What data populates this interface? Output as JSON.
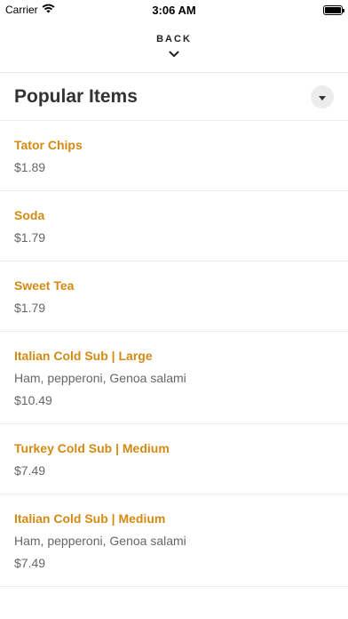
{
  "status_bar": {
    "carrier": "Carrier",
    "time": "3:06 AM"
  },
  "header": {
    "back_label": "BACK"
  },
  "section": {
    "title": "Popular Items"
  },
  "items": [
    {
      "name": "Tator Chips",
      "description": "",
      "price": "$1.89"
    },
    {
      "name": "Soda",
      "description": "",
      "price": "$1.79"
    },
    {
      "name": "Sweet Tea",
      "description": "",
      "price": "$1.79"
    },
    {
      "name": "Italian Cold Sub | Large",
      "description": "Ham, pepperoni, Genoa salami",
      "price": "$10.49"
    },
    {
      "name": "Turkey Cold Sub | Medium",
      "description": "",
      "price": "$7.49"
    },
    {
      "name": "Italian Cold Sub | Medium",
      "description": "Ham, pepperoni, Genoa salami",
      "price": "$7.49"
    }
  ],
  "colors": {
    "accent": "#d48a12",
    "text": "#333333",
    "muted": "#666666"
  },
  "icons": {
    "wifi": "wifi-icon",
    "battery": "battery-icon",
    "back": "chevron-down-icon",
    "dropdown": "caret-down-icon"
  }
}
